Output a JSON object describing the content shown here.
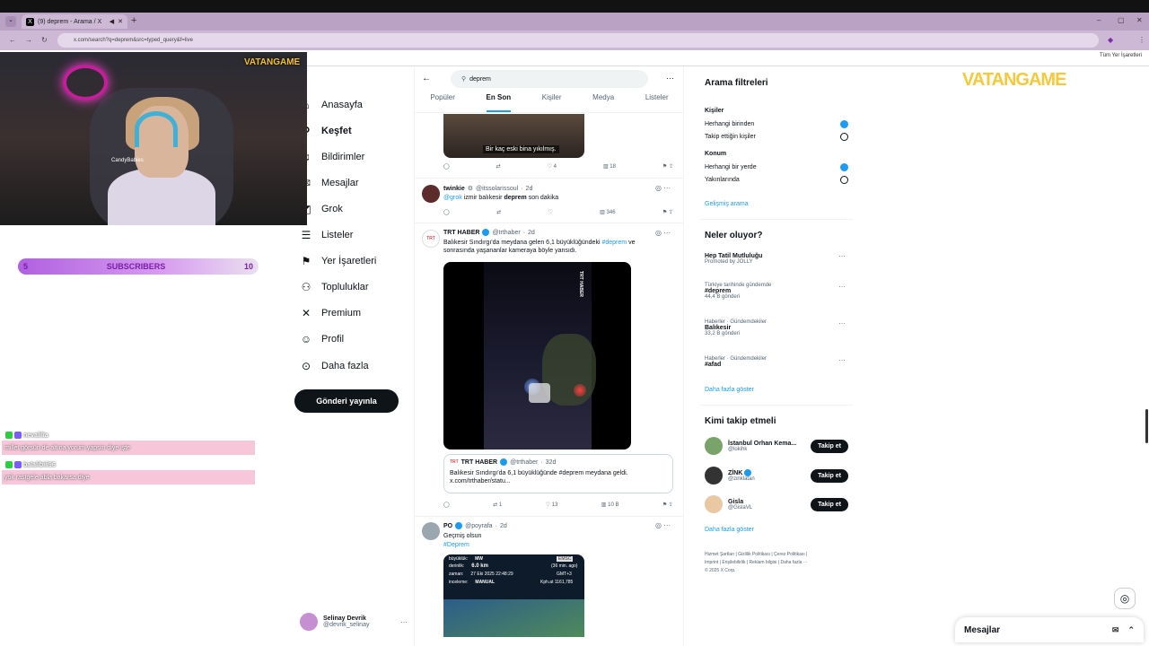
{
  "browser": {
    "tab_title": "(9) deprem - Arama / X",
    "url": "x.com/search?q=deprem&src=typed_query&f=live",
    "bookmarks_right": "Tüm Yer İşaretleri"
  },
  "stream": {
    "cam_logo": "VATANGAME",
    "cam_name": "CandyBabies",
    "sub_left": "5",
    "sub_label": "SUBSCRIBERS",
    "sub_right": "10",
    "chat": [
      {
        "user": "nevalilia",
        "message": "millet görsün de altına yorum yapsın diye işte"
      },
      {
        "user": "balalibiii96",
        "message": "yok rastgele abla bakarsa diye"
      }
    ],
    "overlay_logo": "VATANGAME"
  },
  "nav": {
    "items": [
      {
        "label": "Anasayfa",
        "icon": "home-icon"
      },
      {
        "label": "Keşfet",
        "icon": "search-icon"
      },
      {
        "label": "Bildirimler",
        "icon": "bell-icon"
      },
      {
        "label": "Mesajlar",
        "icon": "mail-icon"
      },
      {
        "label": "Grok",
        "icon": "grok-icon"
      },
      {
        "label": "Listeler",
        "icon": "list-icon"
      },
      {
        "label": "Yer İşaretleri",
        "icon": "bookmark-icon"
      },
      {
        "label": "Topluluklar",
        "icon": "people-icon"
      },
      {
        "label": "Premium",
        "icon": "x-icon"
      },
      {
        "label": "Profil",
        "icon": "person-icon"
      },
      {
        "label": "Daha fazla",
        "icon": "more-icon"
      }
    ],
    "post_button": "Gönderi yayınla",
    "profile_name": "Selinay Devrik",
    "profile_handle": "@devrik_selinay"
  },
  "search": {
    "query": "deprem",
    "tabs": [
      "Popüler",
      "En Son",
      "Kişiler",
      "Medya",
      "Listeler"
    ],
    "active_tab": "En Son"
  },
  "tweets": {
    "t0": {
      "caption": "Bir kaç eski bina yıkılmış.",
      "likes": "4",
      "views": "18"
    },
    "t1": {
      "name": "twinkie",
      "handle": "@itssolarissoul",
      "time": "2d",
      "mention": "@grok",
      "text_a": "izmir balıkesir",
      "text_b": "deprem",
      "text_c": "son dakika",
      "views": "346"
    },
    "t2": {
      "name": "TRT HABER",
      "handle": "@trthaber",
      "time": "2d",
      "text_a": "Balıkesir Sındırgı'da meydana gelen 6,1 büyüklüğündeki",
      "hashtag": "#deprem",
      "text_b": "ve sonrasında yaşananlar kameraya böyle yansıdı.",
      "video_badge": "TRT HABER",
      "quote_name": "TRT HABER",
      "quote_handle": "@trthaber",
      "quote_time": "32d",
      "quote_text": "Balıkesir Sındırgı'da 6,1 büyüklüğünde #deprem meydana geldi.",
      "quote_link": "x.com/trthaber/statu...",
      "retweets": "1",
      "likes": "13",
      "views": "10 B"
    },
    "t3": {
      "name": "PO",
      "handle": "@poyrafa",
      "time": "2d",
      "text": "Geçmiş olsun",
      "hashtag": "#Deprem",
      "card_label1": "büyüklük:",
      "card_value1": "MW",
      "card_label2": "derinlik:",
      "card_value2": "6.0 km",
      "card_label3": "zaman:",
      "card_value3": "27 Eki 2025 22:48:29",
      "card_label4": "inceleme:",
      "card_value4": "MANUAL",
      "card_src": "EMSC",
      "card_ago": "(36 min. ago)",
      "card_tz": "GMT+3",
      "card_dist": "Kph.at 1161,785"
    }
  },
  "filters": {
    "title": "Arama filtreleri",
    "people_label": "Kişiler",
    "people_opt1": "Herhangi birinden",
    "people_opt2": "Takip ettiğin kişiler",
    "loc_label": "Konum",
    "loc_opt1": "Herhangi bir yerde",
    "loc_opt2": "Yakınlarında",
    "advanced": "Gelişmiş arama"
  },
  "trends": {
    "title": "Neler oluyor?",
    "items": [
      {
        "cat": "",
        "name": "Hep Tatil Mutluluğu",
        "count": "Promoted by JOLLY"
      },
      {
        "cat": "Türkiye tarihinde gündemde",
        "name": "#deprem",
        "count": "44,4 B gönderi"
      },
      {
        "cat": "Haberler · Gündemdekiler",
        "name": "Balıkesir",
        "count": "33,2 B gönderi"
      },
      {
        "cat": "Haberler · Gündemdekiler",
        "name": "#afad",
        "count": ""
      }
    ],
    "more": "Daha fazla göster"
  },
  "follow": {
    "title": "Kimi takip etmeli",
    "items": [
      {
        "name": "İstanbul Orhan Kema...",
        "handle": "@lokihk"
      },
      {
        "name": "ZİNK",
        "handle": "@zinklatan"
      },
      {
        "name": "Gisla",
        "handle": "@GislaVL"
      }
    ],
    "button": "Takip et",
    "more": "Daha fazla göster"
  },
  "footer": {
    "line1": "Hizmet Şartları | Gizlilik Politikası | Çerez Politikası |",
    "line2": "Imprint | Erişilebilirlik | Reklam bilgisi | Daha fazla ···",
    "line3": "© 2025 X Corp."
  },
  "messages_bar": "Mesajlar",
  "colors": {
    "accent": "#1d9bf0",
    "text": "#0f1419",
    "muted": "#536471",
    "browser": "#cdb8d6",
    "chat_bg": "#f7c6d8"
  }
}
